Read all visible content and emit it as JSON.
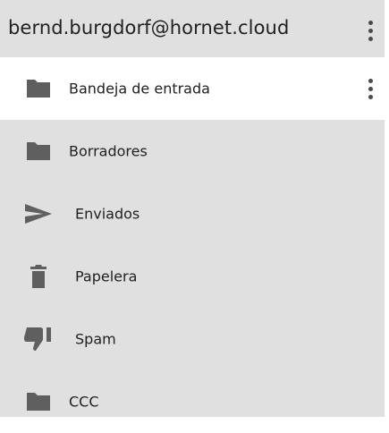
{
  "account": {
    "email": "bernd.burgdorf@hornet.cloud",
    "menu_icon": "more-vert-icon"
  },
  "colors": {
    "panel_background": "#e0e0e0",
    "selected_background": "#ffffff",
    "icon": "#5f5f5f",
    "text": "#212121"
  },
  "folders": [
    {
      "label": "Bandeja de entrada",
      "icon": "folder-icon",
      "selected": true,
      "has_menu": true
    },
    {
      "label": "Borradores",
      "icon": "folder-icon",
      "selected": false
    },
    {
      "label": "Enviados",
      "icon": "send-icon",
      "selected": false
    },
    {
      "label": "Papelera",
      "icon": "trash-icon",
      "selected": false
    },
    {
      "label": "Spam",
      "icon": "thumb-down-icon",
      "selected": false
    },
    {
      "label": "CCC",
      "icon": "folder-icon",
      "selected": false
    }
  ]
}
